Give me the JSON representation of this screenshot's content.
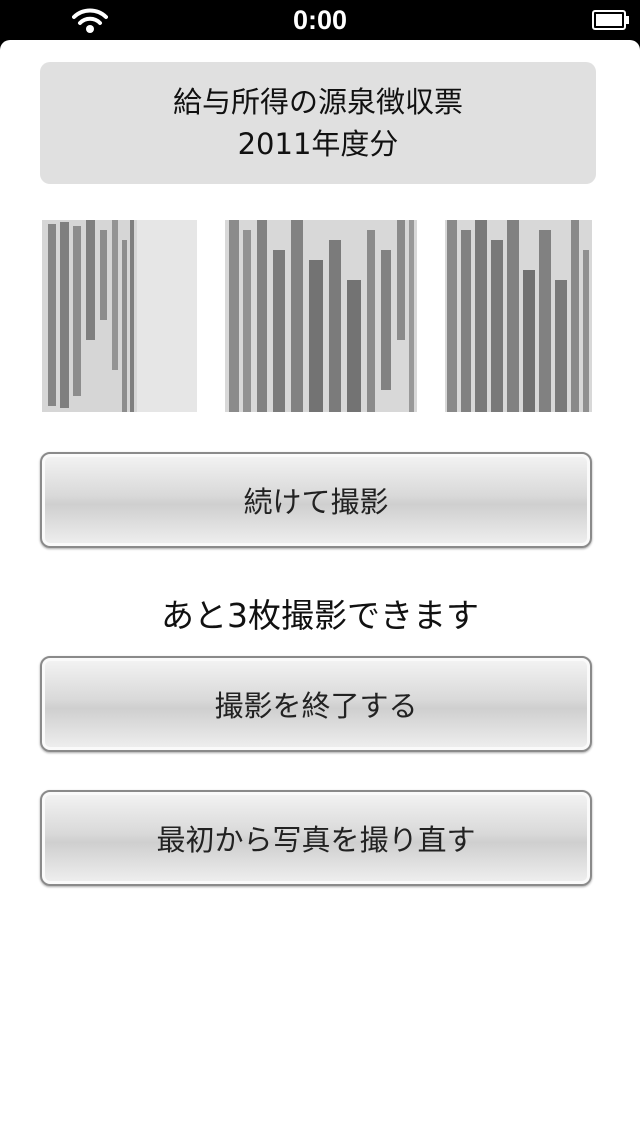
{
  "status_bar": {
    "time": "0:00",
    "wifi_icon": "wifi-icon",
    "battery_icon": "battery-icon"
  },
  "document": {
    "title_line1": "給与所得の源泉徴収票",
    "title_line2": "2011年度分"
  },
  "thumbnails": [
    {
      "name": "captured-photo-1",
      "icon": "document-photo"
    },
    {
      "name": "captured-photo-2",
      "icon": "document-photo"
    },
    {
      "name": "captured-photo-3",
      "icon": "document-photo"
    }
  ],
  "actions": {
    "continue_label": "続けて撮影",
    "remaining_text": "あと3枚撮影できます",
    "finish_label": "撮影を終了する",
    "retake_label": "最初から写真を撮り直す"
  }
}
